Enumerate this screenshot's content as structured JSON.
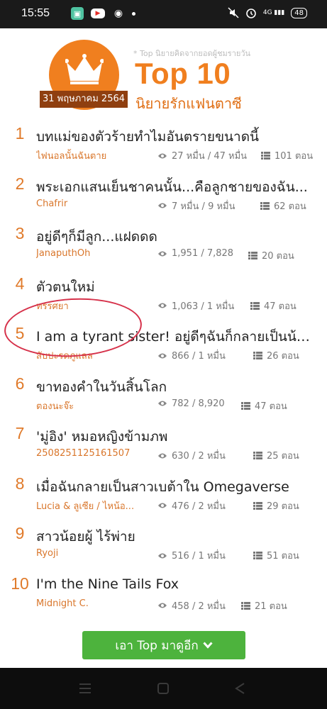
{
  "status_bar": {
    "time": "15:55",
    "icons": [
      "app-icon",
      "youtube-icon",
      "eye-app-icon",
      "dot-icon"
    ],
    "right_icons": [
      "mute-icon",
      "alarm-icon",
      "signal-icon"
    ],
    "signal_label": "4G",
    "battery": "48"
  },
  "header": {
    "date": "31 พฤษภาคม 2564",
    "note": "* Top นิยายคิดจากยอดผู้ชมรายวัน",
    "title": "Top 10",
    "subtitle": "นิยายรักแฟนตาซี",
    "accent": "#f07f1f"
  },
  "list": [
    {
      "rank": "1",
      "title": "บทแม่ของตัวร้ายทำไมอันตรายขนาดนี้",
      "author": "ไฟนอลนั้นฉันตาย",
      "views": "27 หมื่น / 47 หมื่น",
      "episodes": "101 ตอน"
    },
    {
      "rank": "2",
      "title": "พระเอกแสนเย็นชาคนนั้น...คือลูกชายของฉัน...",
      "author": "Chafrir",
      "views": "7 หมื่น / 9 หมื่น",
      "episodes": "62 ตอน"
    },
    {
      "rank": "3",
      "title": "อยู่ดีๆก็มีลูก...แฝดดด",
      "author": "JanaputhOh",
      "views": "1,951 / 7,828",
      "episodes": "20 ตอน"
    },
    {
      "rank": "4",
      "title": "ตัวตนใหม่",
      "author": "ทรรศยา",
      "views": "1,063 / 1 หมื่น",
      "episodes": "47 ตอน"
    },
    {
      "rank": "5",
      "title": "I am a tyrant sister! อยู่ดีๆฉันก็กลายเป็นน้อ...",
      "author": "สับปะรดภูแลล",
      "views": "866 / 1 หมื่น",
      "episodes": "26 ตอน"
    },
    {
      "rank": "6",
      "title": "ขาทองคำในวันสิ้นโลก",
      "author": "ตองนะจ๊ะ",
      "views": "782 / 8,920",
      "episodes": "47 ตอน"
    },
    {
      "rank": "7",
      "title": "'มู่อิง' หมอหญิงข้ามภพ",
      "author": "2508251125161507",
      "views": "630 / 2 หมื่น",
      "episodes": "25 ตอน"
    },
    {
      "rank": "8",
      "title": "เมื่อฉันกลายเป็นสาวเบต้าใน Omegaverse",
      "author": "Lucia & ลูเซีย / ไหน้อ...",
      "views": "476 / 2 หมื่น",
      "episodes": "29 ตอน"
    },
    {
      "rank": "9",
      "title": "สาวน้อยผู้ ไร้พ่าย",
      "author": "Ryoji",
      "views": "516 / 1 หมื่น",
      "episodes": "51 ตอน"
    },
    {
      "rank": "10",
      "title": "I'm the Nine Tails Fox",
      "author": "Midnight C.",
      "views": "458 / 2 หมื่น",
      "episodes": "21 ตอน"
    }
  ],
  "more_button": {
    "label": "เอา Top มาดูอีก",
    "color": "#4db33d"
  },
  "nav_bar": {
    "icons": [
      "recent-apps-icon",
      "home-icon",
      "back-icon"
    ]
  }
}
